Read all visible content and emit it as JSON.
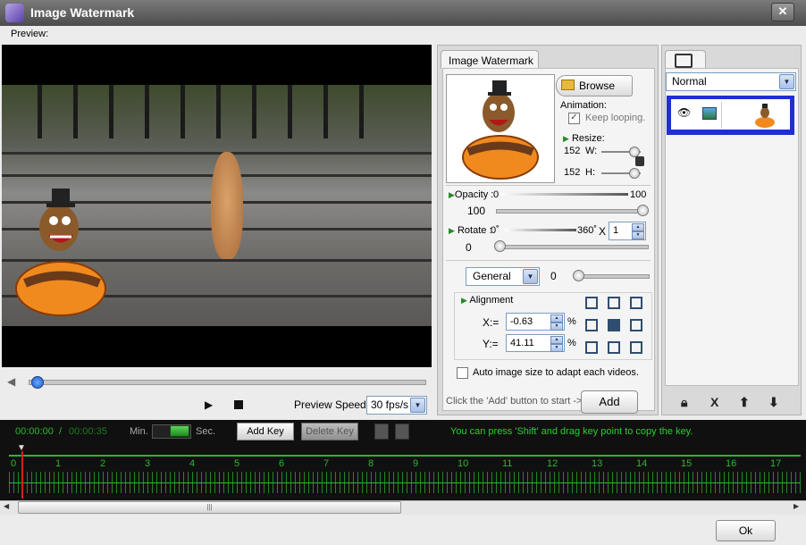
{
  "window": {
    "title": "Image Watermark",
    "close_glyph": "✕"
  },
  "preview": {
    "label": "Preview:"
  },
  "player": {
    "speed_label": "Preview Speed:",
    "speed_value": "30 fps/s"
  },
  "watermark_tab": {
    "title": "Image Watermark",
    "browse_label": "Browse",
    "animation_label": "Animation:",
    "keep_looping_label": "Keep looping.",
    "keep_looping_checked": true,
    "resize_label": "Resize:",
    "width_value": "152",
    "width_label": "W:",
    "height_value": "152",
    "height_label": "H:",
    "opacity_label": "Opacity :",
    "opacity_min": "0",
    "opacity_max": "100",
    "opacity_value": "100",
    "rotate_label": "Rotate :",
    "rotate_min": "0˚",
    "rotate_max": "360˚",
    "rotate_x": "X",
    "rotate_multiplier": "1",
    "rotate_value": "0",
    "general_select": "General",
    "general_value": "0",
    "alignment_label": "Alignment",
    "x_label": "X:=",
    "x_value": "-0.63",
    "x_unit": "%",
    "y_label": "Y:=",
    "y_value": "41.11",
    "y_unit": "%",
    "auto_size_label": "Auto image size to adapt each videos.",
    "hint_add": "Click the 'Add' button to start ->",
    "add_label": "Add"
  },
  "layers": {
    "blend_mode": "Normal",
    "tools": [
      "lock-icon",
      "delete-icon",
      "move-up-icon",
      "move-down-icon"
    ]
  },
  "timeline": {
    "current_time": "00:00:00",
    "separator": "/",
    "total_time": "00:00:35",
    "min_label": "Min.",
    "sec_label": "Sec.",
    "add_key_label": "Add Key",
    "delete_key_label": "Delete Key",
    "tip": "You can press 'Shift' and drag key point to copy the key.",
    "ticks": [
      "0",
      "1",
      "2",
      "3",
      "4",
      "5",
      "6",
      "7",
      "8",
      "9",
      "10",
      "11",
      "12",
      "13",
      "14",
      "15",
      "16",
      "17"
    ]
  },
  "footer": {
    "ok_label": "Ok"
  },
  "colors": {
    "accent_green": "#2fb52f",
    "layer_selected": "#1f2fd0",
    "titlebar": "#5a5a5a"
  }
}
